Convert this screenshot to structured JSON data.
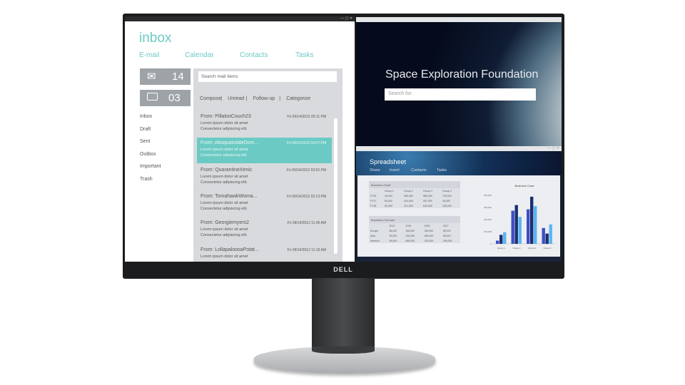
{
  "brand": {
    "logo": "DELL"
  },
  "mail_app": {
    "title": "inbox",
    "nav": [
      "E-mail",
      "Calendar",
      "Contacts",
      "Tasks"
    ],
    "counters": [
      {
        "icon": "envelope-icon",
        "value": "14"
      },
      {
        "icon": "chat-bubble-icon",
        "value": "03"
      }
    ],
    "folders": [
      "Inbox",
      "Draft",
      "Sent",
      "Outbox",
      "Important",
      "Trash"
    ],
    "search_placeholder": "Search mail items",
    "toolbar": [
      "Compose",
      "|",
      "Unread",
      "|",
      "Follow-up",
      "|",
      "Categorize"
    ],
    "messages": [
      {
        "from": "From: PillalooCouch23",
        "date": "Fri 09/14/2012 05:11 PM",
        "line1": "Lorem ipsum dolor sit amet",
        "line2": "Consectetur adipiscing elit.",
        "selected": false
      },
      {
        "from": "From: AbsquatulateDom...",
        "date": "Fri 09/14/2012 04:07 PM",
        "line1": "Lorem ipsum dolor sit amet",
        "line2": "Consectetur adipiscing elit.",
        "selected": true
      },
      {
        "from": "From: QuarantineXenic",
        "date": "Fri 09/14/2012 03:52 PM",
        "line1": "Lorem ipsum dolor sit amet",
        "line2": "Consectetur adipiscing elit.",
        "selected": false
      },
      {
        "from": "From: TomahawkWoma...",
        "date": "Fri 09/14/2012 02:13 PM",
        "line1": "Lorem ipsum dolor sit amet",
        "line2": "Consectetur adipiscing elit.",
        "selected": false
      },
      {
        "from": "From: Georgiemyers2",
        "date": "Fri 09/14/2012 11:45 AM",
        "line1": "Lorem ipsum dolor sit amet",
        "line2": "Consectetur adipiscing elit.",
        "selected": false
      },
      {
        "from": "From: LollapaloosaPotat...",
        "date": "Fri 09/14/2012 11:19 AM",
        "line1": "Lorem ipsum dolor sit amet",
        "line2": "",
        "selected": false
      }
    ],
    "accent": "#6ccac4"
  },
  "browser": {
    "title": "Space Exploration Foundation",
    "search_placeholder": "Search for:"
  },
  "spreadsheet": {
    "title": "Spreadsheet",
    "tabs": [
      "Share",
      "Insert",
      "Contacts",
      "Tasks"
    ],
    "table1": {
      "title": "Business Chart",
      "headers": [
        "",
        "Group 1",
        "Group 2",
        "Group 3",
        "Group 4"
      ],
      "rows": [
        [
          "FY16",
          "40,000",
          "380,000",
          "580,000",
          "700,000"
        ],
        [
          "FY17",
          "65,000",
          "420,000",
          "507,000",
          "46,000"
        ],
        [
          "FY18",
          "90,000",
          "471,000",
          "620,000",
          "160,000"
        ]
      ]
    },
    "table2": {
      "title": "Business Forecast",
      "headers": [
        "",
        "2014",
        "2015",
        "2016",
        "2017"
      ],
      "rows": [
        [
          "Europe",
          "65,000",
          "360,000",
          "340,000",
          "55,000"
        ],
        [
          "Asia",
          "90,000",
          "330,000",
          "480,000",
          "68,000"
        ],
        [
          "America",
          "95,000",
          "660,000",
          "320,000",
          "290,000"
        ]
      ]
    }
  },
  "chart_data": {
    "type": "bar",
    "title": "Business Chart",
    "categories": [
      "Group 1",
      "Group 2",
      "Group 3",
      "Group 4"
    ],
    "series": [
      {
        "values": [
          53000,
          547000,
          569000,
          262000
        ]
      },
      {
        "values": [
          148000,
          640000,
          778000,
          169000
        ]
      },
      {
        "values": [
          191000,
          444000,
          622000,
          320000
        ]
      }
    ],
    "colors": [
      "#3d4fc2",
      "#1a2f70",
      "#5ab4f0"
    ],
    "ylim": [
      0,
      800000
    ],
    "yticks": [
      "0",
      "200,000",
      "400,000",
      "600,000",
      "800,000"
    ]
  }
}
